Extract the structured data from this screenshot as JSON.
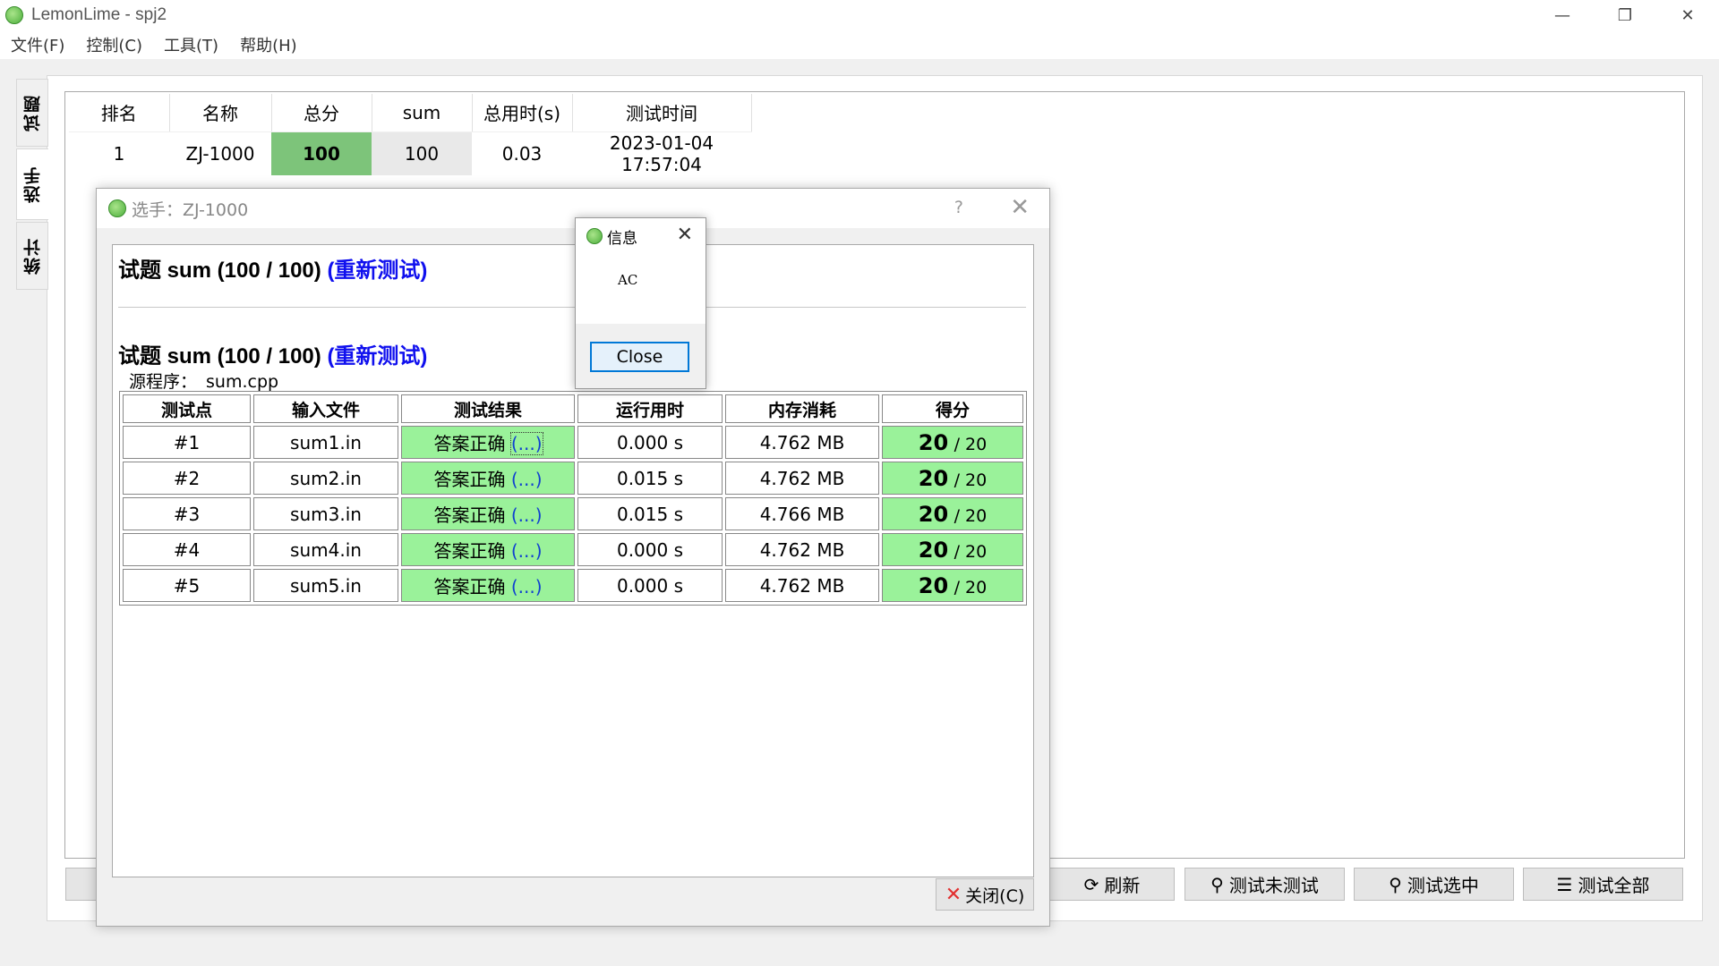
{
  "window": {
    "title": "LemonLime - spj2",
    "controls": {
      "minimize": "—",
      "restore": "❐",
      "close": "✕"
    }
  },
  "menu": [
    "文件(F)",
    "控制(C)",
    "工具(T)",
    "帮助(H)"
  ],
  "side_tabs": [
    "试题",
    "选手",
    "统计"
  ],
  "ranking": {
    "headers": [
      "排名",
      "名称",
      "总分",
      "sum",
      "总用时(s)",
      "测试时间"
    ],
    "rows": [
      {
        "rank": "1",
        "name": "ZJ-1000",
        "total": "100",
        "sum": "100",
        "time": "0.03",
        "tested_at": "2023-01-04 17:57:04"
      }
    ]
  },
  "bottom_buttons": {
    "refresh": "刷新",
    "test_untested": "测试未测试",
    "test_selected": "测试选中",
    "test_all": "测试全部"
  },
  "dialog": {
    "title": "选手：ZJ-1000",
    "help": "?",
    "close_glyph": "✕",
    "problem_heading": "试题 sum (100 / 100)",
    "retest": "(重新测试)",
    "source_label": "源程序：",
    "source_file": "sum.cpp",
    "table_headers": [
      "测试点",
      "输入文件",
      "测试结果",
      "运行用时",
      "内存消耗",
      "得分"
    ],
    "rows": [
      {
        "point": "#1",
        "input": "sum1.in",
        "result": "答案正确",
        "detail": "(...)",
        "time": "0.000 s",
        "memory": "4.762 MB",
        "score": "20",
        "full": "/ 20"
      },
      {
        "point": "#2",
        "input": "sum2.in",
        "result": "答案正确",
        "detail": "(...)",
        "time": "0.015 s",
        "memory": "4.762 MB",
        "score": "20",
        "full": "/ 20"
      },
      {
        "point": "#3",
        "input": "sum3.in",
        "result": "答案正确",
        "detail": "(...)",
        "time": "0.015 s",
        "memory": "4.766 MB",
        "score": "20",
        "full": "/ 20"
      },
      {
        "point": "#4",
        "input": "sum4.in",
        "result": "答案正确",
        "detail": "(...)",
        "time": "0.000 s",
        "memory": "4.762 MB",
        "score": "20",
        "full": "/ 20"
      },
      {
        "point": "#5",
        "input": "sum5.in",
        "result": "答案正确",
        "detail": "(...)",
        "time": "0.000 s",
        "memory": "4.762 MB",
        "score": "20",
        "full": "/ 20"
      }
    ],
    "close_button": "关闭(C)"
  },
  "message_box": {
    "title": "信息",
    "text": "AC",
    "button": "Close"
  },
  "colors": {
    "ok_green": "#9af29a",
    "total_green": "#7dc47a",
    "link_blue": "#1010ee",
    "focus_blue": "#0078d7"
  }
}
